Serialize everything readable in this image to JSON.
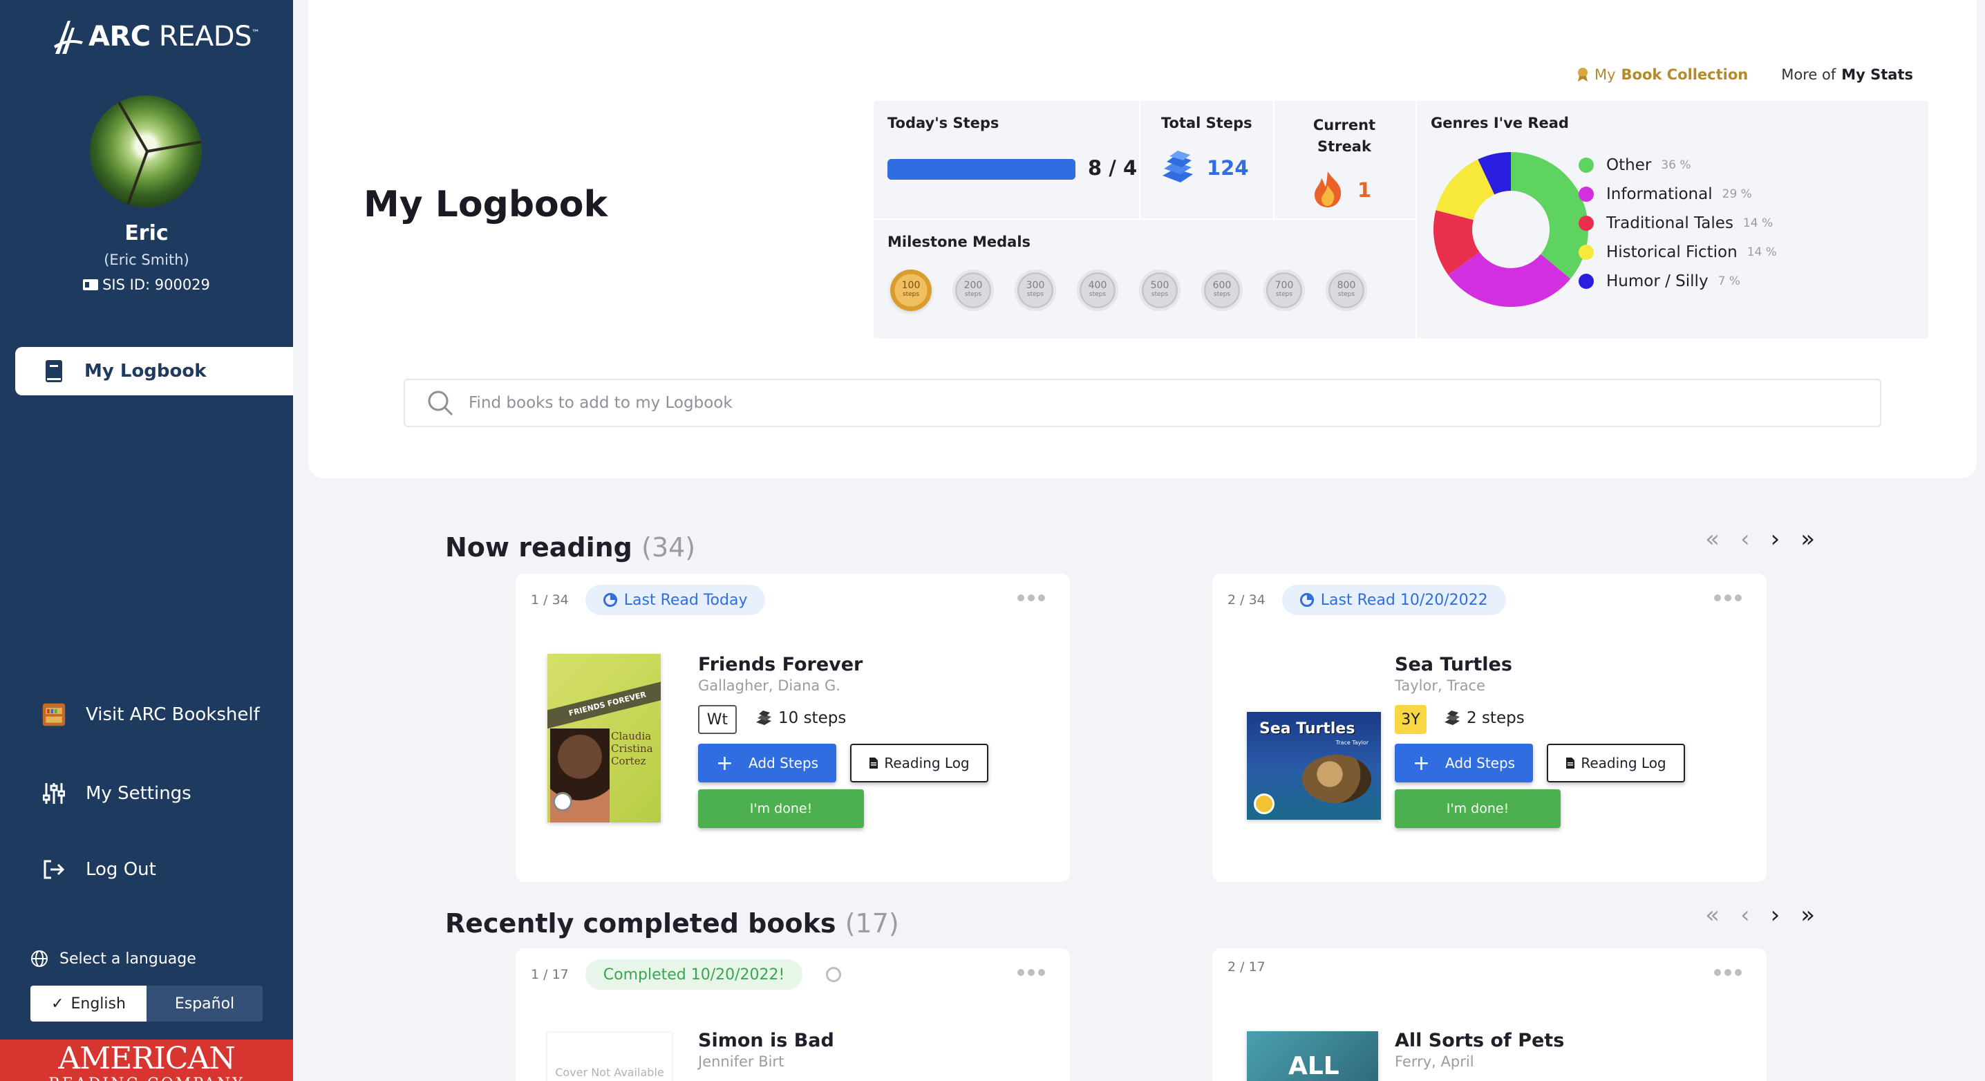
{
  "sidebar": {
    "logo_primary": "ARC",
    "logo_secondary": "READS",
    "logo_tm": "™",
    "user_name": "Eric",
    "user_full_name": "(Eric Smith)",
    "sis_id": "SIS ID: 900029",
    "nav_active": "My Logbook",
    "nav_items": [
      "Visit ARC Bookshelf",
      "My Settings",
      "Log Out"
    ],
    "language_label": "Select a language",
    "languages": [
      "English",
      "Español"
    ],
    "selected_language": "English",
    "footer_line1": "AMERICAN",
    "footer_line2": "READING COMPANY"
  },
  "header": {
    "book_collection_prefix": "My",
    "book_collection_hl": "Book Collection",
    "stats_prefix": "More of",
    "stats_hl": "My Stats",
    "page_title": "My Logbook"
  },
  "stats": {
    "todays_steps_label": "Today's Steps",
    "todays_steps_value": "8 / 4",
    "todays_progress": 1.0,
    "total_steps_label": "Total Steps",
    "total_steps_value": "124",
    "streak_label_1": "Current",
    "streak_label_2": "Streak",
    "streak_value": "1",
    "milestones_label": "Milestone Medals",
    "medals": [
      {
        "value": "100",
        "unit": "steps",
        "earned": true
      },
      {
        "value": "200",
        "unit": "steps",
        "earned": false
      },
      {
        "value": "300",
        "unit": "steps",
        "earned": false
      },
      {
        "value": "400",
        "unit": "steps",
        "earned": false
      },
      {
        "value": "500",
        "unit": "steps",
        "earned": false
      },
      {
        "value": "600",
        "unit": "steps",
        "earned": false
      },
      {
        "value": "700",
        "unit": "steps",
        "earned": false
      },
      {
        "value": "800",
        "unit": "steps",
        "earned": false
      }
    ],
    "genres_label": "Genres I've Read",
    "genres": [
      {
        "name": "Other",
        "pct": "36 %",
        "value": 36,
        "color": "#5fd35f"
      },
      {
        "name": "Informational",
        "pct": "29 %",
        "value": 29,
        "color": "#d12fe0"
      },
      {
        "name": "Traditional Tales",
        "pct": "14 %",
        "value": 14,
        "color": "#ea2f4e"
      },
      {
        "name": "Historical Fiction",
        "pct": "14 %",
        "value": 14,
        "color": "#f8e83a"
      },
      {
        "name": "Humor / Silly",
        "pct": "7 %",
        "value": 7,
        "color": "#2a1ee0"
      }
    ]
  },
  "search": {
    "placeholder": "Find books to add to my Logbook"
  },
  "now_reading": {
    "title": "Now reading",
    "count": "(34)",
    "cards": [
      {
        "index": "1 / 34",
        "badge": "Last Read Today",
        "title": "Friends Forever",
        "author": "Gallagher, Diana G.",
        "level": "Wt",
        "steps": "10 steps",
        "add_label": "Add Steps",
        "log_label": "Reading Log",
        "done_label": "I'm done!",
        "cover_title": "FRIENDS FOREVER",
        "cover_sub": "Claudia Cristina Cortez"
      },
      {
        "index": "2 / 34",
        "badge": "Last Read 10/20/2022",
        "title": "Sea Turtles",
        "author": "Taylor, Trace",
        "level": "3Y",
        "steps": "2 steps",
        "add_label": "Add Steps",
        "log_label": "Reading Log",
        "done_label": "I'm done!",
        "cover_title": "Sea Turtles",
        "cover_sub": "Trace Taylor"
      }
    ]
  },
  "completed": {
    "title": "Recently completed books",
    "count": "(17)",
    "cards": [
      {
        "index": "1 / 17",
        "badge": "Completed 10/20/2022!",
        "title": "Simon is Bad",
        "author": "Jennifer Birt",
        "cover_text": "Cover Not Available"
      },
      {
        "index": "2 / 17",
        "title": "All Sorts of Pets",
        "author": "Ferry, April",
        "cover_text": "ALL"
      }
    ]
  },
  "colors": {
    "sidebar": "#1e3a5f",
    "accent_blue": "#2f6de0",
    "done_green": "#4caf50",
    "brand_red": "#d6362f"
  }
}
